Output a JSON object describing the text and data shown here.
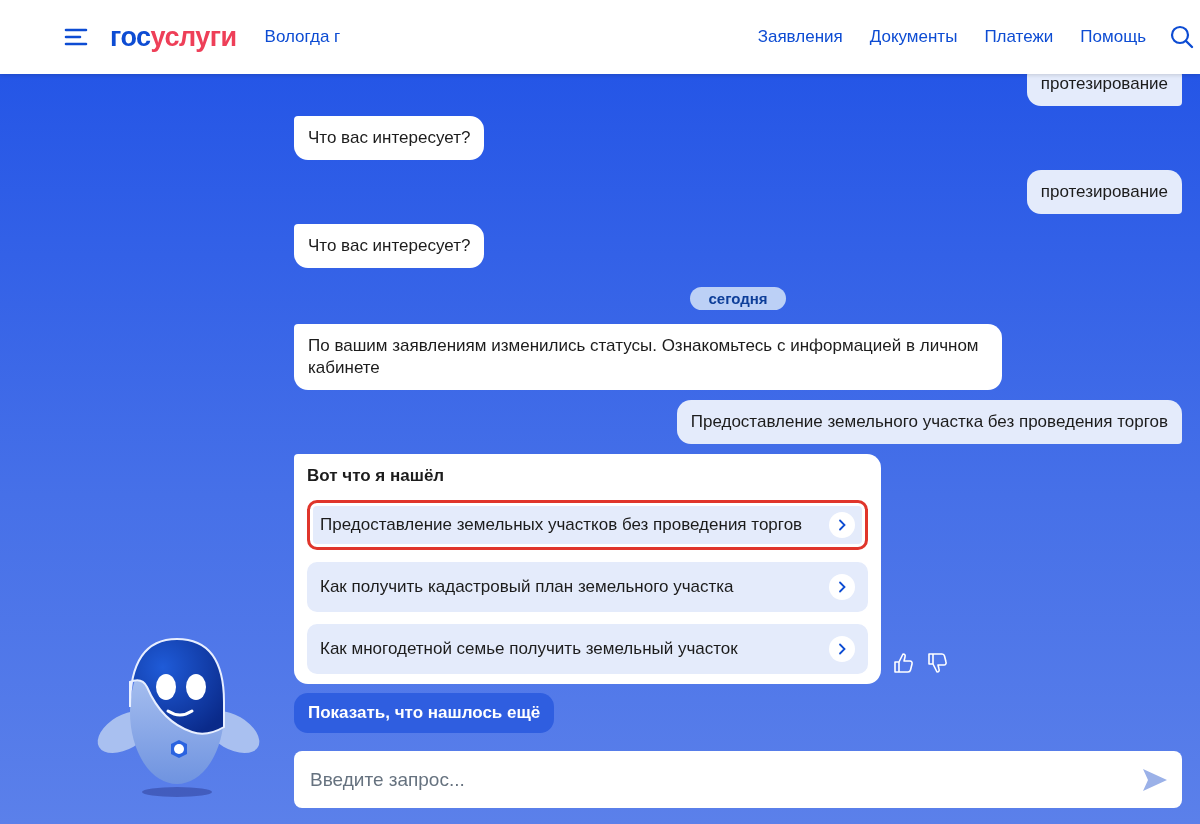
{
  "header": {
    "logo": {
      "prefix": "гос",
      "suffix": "услуги"
    },
    "city": "Вологда г",
    "nav": [
      "Заявления",
      "Документы",
      "Платежи",
      "Помощь"
    ]
  },
  "messages": [
    {
      "kind": "user",
      "text": "протезирование"
    },
    {
      "kind": "bot",
      "text": "Что вас интересует?"
    },
    {
      "kind": "user",
      "text": "протезирование"
    },
    {
      "kind": "bot",
      "text": "Что вас интересует?"
    },
    {
      "kind": "date",
      "text": "сегодня"
    },
    {
      "kind": "bot",
      "text": "По вашим заявлениям изменились статусы. Ознакомьтесь с информацией в личном кабинете"
    },
    {
      "kind": "user",
      "text": "Предоставление земельного участка без проведения торгов"
    },
    {
      "kind": "results",
      "title": "Вот что я нашёл",
      "items": [
        {
          "label": "Предоставление земельных участков без проведения торгов",
          "selected": true
        },
        {
          "label": "Как получить кадастровый план земельного участка",
          "selected": false
        },
        {
          "label": "Как многодетной семье получить земельный участок",
          "selected": false
        }
      ]
    }
  ],
  "show_more": "Показать, что нашлось ещё",
  "input": {
    "placeholder": "Введите запрос..."
  }
}
